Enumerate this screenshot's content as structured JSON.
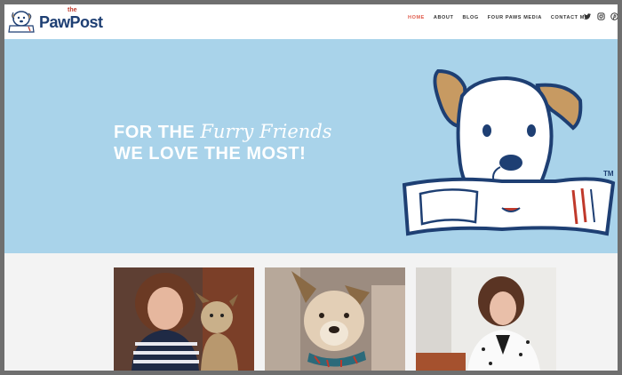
{
  "logo": {
    "the": "the",
    "name": "PawPost",
    "alt": "The Paw Post logo"
  },
  "nav": {
    "items": [
      "Home",
      "About",
      "Blog",
      "Four Paws Media",
      "Contact Me"
    ],
    "active": "Home"
  },
  "social": {
    "icons": [
      "twitter-icon",
      "instagram-icon",
      "pinterest-icon"
    ]
  },
  "hero": {
    "line1_plain": "FOR THE ",
    "line1_script": "Furry Friends",
    "line2": "WE LOVE THE MOST!",
    "tm": "TM",
    "background": "#a9d3ea"
  },
  "photos": [
    {
      "name": "woman-with-terrier-photo"
    },
    {
      "name": "dog-with-collar-photo"
    },
    {
      "name": "woman-at-desk-photo"
    }
  ],
  "colors": {
    "accent": "#e05a4a",
    "navy": "#1e3f73",
    "hero": "#a9d3ea"
  }
}
